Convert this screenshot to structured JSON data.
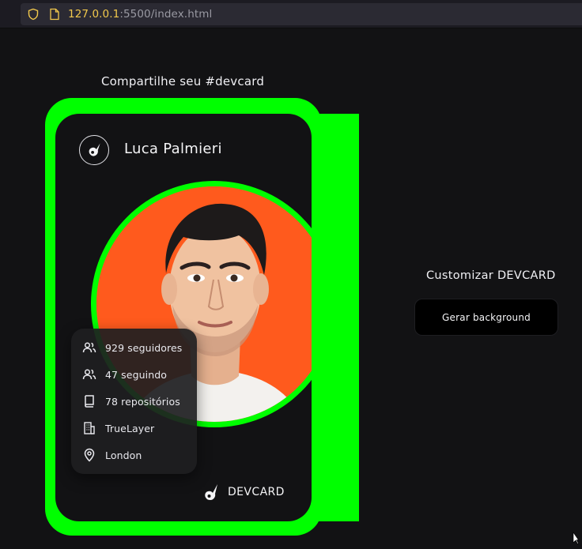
{
  "browser": {
    "url_host": "127.0.0.1",
    "url_rest": ":5500/index.html"
  },
  "share": {
    "title": "Compartilhe seu #devcard"
  },
  "card": {
    "user_name": "Luca Palmieri",
    "stats": [
      {
        "icon": "followers-icon",
        "label": "929 seguidores"
      },
      {
        "icon": "following-icon",
        "label": "47 seguindo"
      },
      {
        "icon": "repository-icon",
        "label": "78 repositórios"
      },
      {
        "icon": "company-icon",
        "label": "TrueLayer"
      },
      {
        "icon": "location-icon",
        "label": "London"
      }
    ],
    "brand_label": "DEVCARD",
    "frame_color": "#00ff00",
    "background_color": "#121214",
    "avatar_background": "#ff5a1d"
  },
  "customize": {
    "title": "Customizar DEVCARD",
    "button_label": "Gerar background"
  }
}
